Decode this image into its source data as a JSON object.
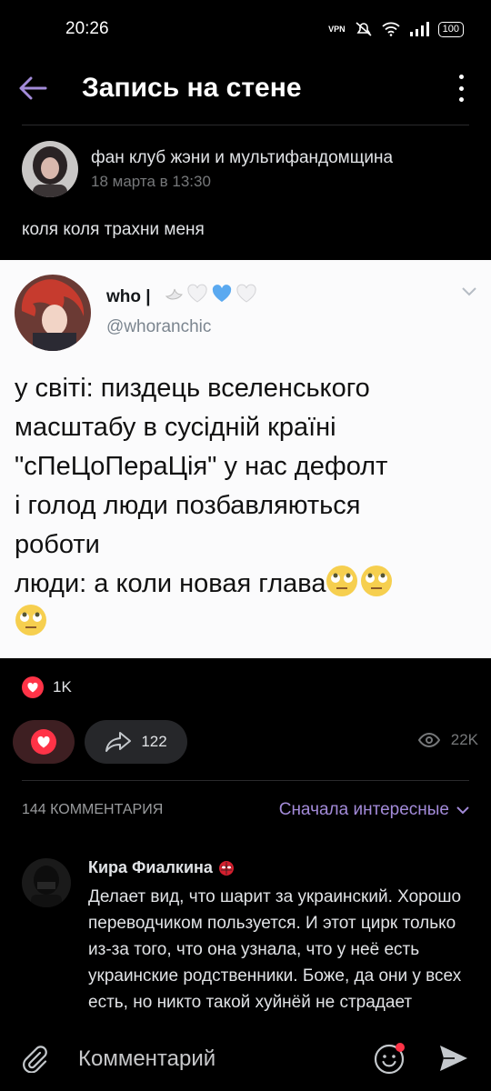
{
  "status_bar": {
    "time": "20:26",
    "vpn": "VPN",
    "battery": "100"
  },
  "header": {
    "title": "Запись на стене"
  },
  "post": {
    "author": "фан клуб жэни и мультифандомщина",
    "date": "18 марта в 13:30",
    "text": "коля коля трахни меня"
  },
  "embed": {
    "name": "who |",
    "handle": "@whoranchic",
    "lines": [
      "у світі: пиздець вселенського",
      "масштабу в сусідній країні",
      "\"сПеЦоПераЦія\" у нас дефолт",
      "і голод люди позбавляються",
      "роботи",
      "люди: а коли новая глава"
    ]
  },
  "stats": {
    "likes": "1K",
    "shares": "122",
    "views": "22K"
  },
  "comments": {
    "count_label": "144 КОММЕНТАРИЯ",
    "sort_label": "Сначала интересные",
    "items": [
      {
        "author": "Кира Фиалкина",
        "text": "Делает вид, что шарит за украинский. Хорошо переводчиком пользуется. И этот цирк только из-за того, что она узнала, что у неё есть украинские родственники. Боже, да они у всех есть, но никто такой хуйнёй не страдает"
      }
    ]
  },
  "composer": {
    "placeholder": "Комментарий"
  },
  "colors": {
    "accent": "#a38bd9",
    "like_red": "#ff3347",
    "background": "#000000",
    "embed_bg": "#fbfbfc"
  }
}
